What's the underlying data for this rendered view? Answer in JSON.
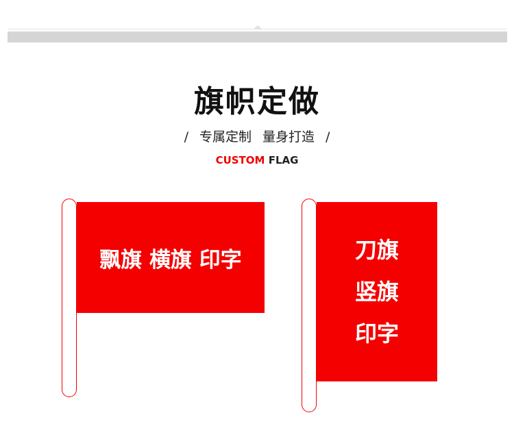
{
  "header": {
    "title": "旗帜定做",
    "subtitle_left": "/",
    "subtitle_a": "专属定制",
    "subtitle_b": "量身打造",
    "subtitle_right": "/",
    "en_red": "CUSTOM",
    "en_black": "FLAG"
  },
  "flags": [
    {
      "text": "飘旗 横旗 印字"
    },
    {
      "lines": [
        "刀旗",
        "竖旗",
        "印字"
      ]
    }
  ],
  "colors": {
    "accent": "#f50000"
  }
}
